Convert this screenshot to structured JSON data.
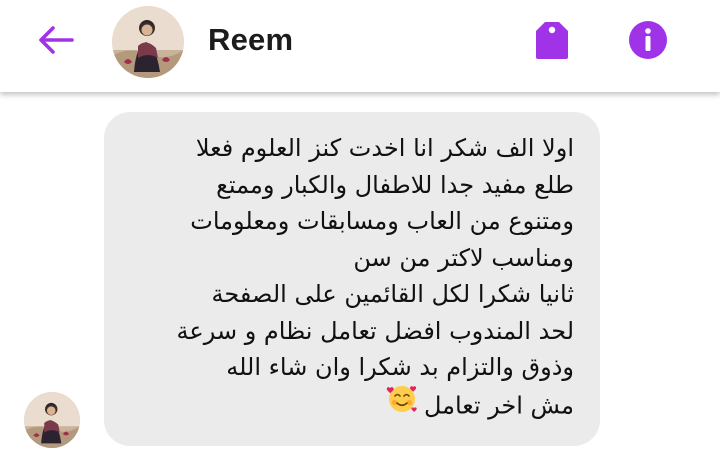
{
  "header": {
    "contact_name": "Reem",
    "back_icon": "back-arrow-icon",
    "tag_icon": "tag-icon",
    "info_icon": "info-icon"
  },
  "message": {
    "sender": "Reem",
    "text": "اولا الف شكر  انا اخدت كنز العلوم فعلا\nطلع مفيد جدا للاطفال والكبار وممتع\nومتنوع من العاب ومسابقات ومعلومات\nومناسب لاكتر من سن\nثانيا شكرا لكل القائمين على الصفحة\nلحد المندوب افضل تعامل نظام و سرعة\nوذوق والتزام بد شكرا وان شاء الله\nمش اخر تعامل",
    "emoji_icon": "smiling-face-with-hearts-icon"
  },
  "colors": {
    "accent": "#A033E8",
    "bubble_bg": "#EBEBEB",
    "text": "#111111",
    "header_bg": "#FFFFFF"
  }
}
